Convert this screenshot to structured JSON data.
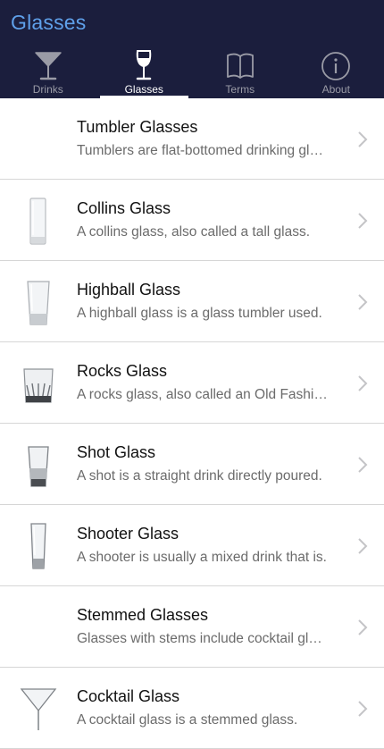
{
  "app": {
    "title": "Glasses"
  },
  "tabs": [
    {
      "label": "Drinks",
      "icon": "cocktail-glass-icon",
      "active": false
    },
    {
      "label": "Glasses",
      "icon": "wine-glass-icon",
      "active": true
    },
    {
      "label": "Terms",
      "icon": "book-icon",
      "active": false
    },
    {
      "label": "About",
      "icon": "info-icon",
      "active": false
    }
  ],
  "colors": {
    "header_bg": "#1b1e3d",
    "title": "#5fa0ea",
    "tab_inactive": "#9a9ba6",
    "tab_active": "#ffffff"
  },
  "list": {
    "items": [
      {
        "title": "Tumbler Glasses",
        "description": "Tumblers are flat-bottomed drinking glasses.",
        "image": "none"
      },
      {
        "title": "Collins Glass",
        "description": "A collins glass, also called a tall glass.",
        "image": "collins-glass-image"
      },
      {
        "title": "Highball Glass",
        "description": "A highball glass is a glass tumbler used.",
        "image": "highball-glass-image"
      },
      {
        "title": "Rocks Glass",
        "description": "A rocks glass, also called an Old Fashioned glass.",
        "image": "rocks-glass-image"
      },
      {
        "title": "Shot Glass",
        "description": "A shot is a straight drink directly poured.",
        "image": "shot-glass-image"
      },
      {
        "title": "Shooter Glass",
        "description": "A shooter is usually a mixed drink that is.",
        "image": "shooter-glass-image"
      },
      {
        "title": "Stemmed Glasses",
        "description": "Glasses with stems include cocktail glasses.",
        "image": "none"
      },
      {
        "title": "Cocktail Glass",
        "description": "A cocktail glass is a stemmed glass.",
        "image": "cocktail-glass-image"
      }
    ]
  }
}
